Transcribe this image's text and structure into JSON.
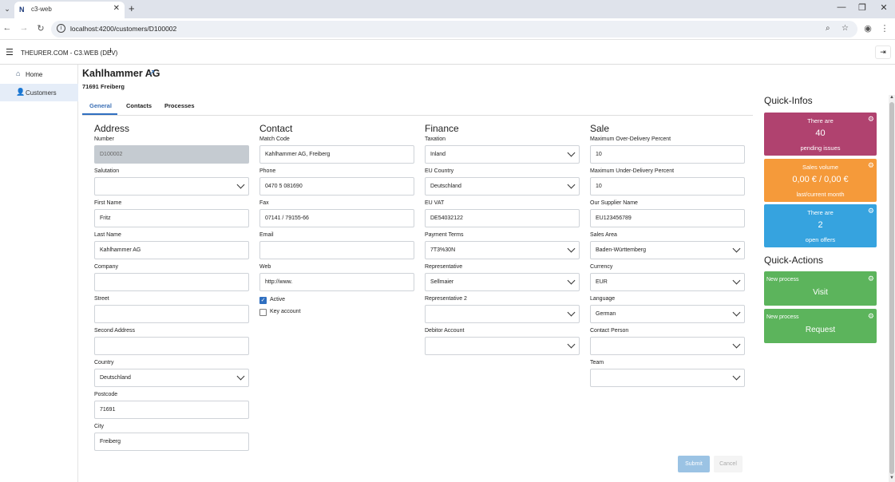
{
  "browser": {
    "tab_title": "c3-web",
    "tab_favicon": "N",
    "url": "localhost:4200/customers/D100002"
  },
  "app": {
    "title": "THEURER.COM - C3.WEB (DEV)",
    "info_glyph": "i"
  },
  "sidebar": {
    "items": [
      {
        "label": "Home",
        "icon": "home-icon"
      },
      {
        "label": "Customers",
        "icon": "user-icon"
      }
    ]
  },
  "customer": {
    "name": "Kahlhammer AG",
    "city_line": "71691 Freiberg"
  },
  "tabs": [
    "General",
    "Contacts",
    "Processes"
  ],
  "sections": {
    "address": "Address",
    "contact": "Contact",
    "finance": "Finance",
    "sale": "Sale"
  },
  "address": {
    "number_label": "Number",
    "number": "D100002",
    "salutation_label": "Salutation",
    "salutation": "",
    "first_name_label": "First Name",
    "first_name": "Fritz",
    "last_name_label": "Last Name",
    "last_name": "Kahlhammer AG",
    "company_label": "Company",
    "company": "",
    "street_label": "Street",
    "street": "",
    "second_address_label": "Second Address",
    "second_address": "",
    "country_label": "Country",
    "country": "Deutschland",
    "postcode_label": "Postcode",
    "postcode": "71691",
    "city_label": "City",
    "city": "Freiberg"
  },
  "contact": {
    "match_code_label": "Match Code",
    "match_code": "Kahlhammer AG, Freiberg",
    "phone_label": "Phone",
    "phone": "0470 5 081690",
    "fax_label": "Fax",
    "fax": "07141 / 79155-66",
    "email_label": "Email",
    "email": "",
    "web_label": "Web",
    "web": "http://www.",
    "active_label": "Active",
    "active": true,
    "key_account_label": "Key account",
    "key_account": false
  },
  "finance": {
    "taxation_label": "Taxation",
    "taxation": "Inland",
    "eu_country_label": "EU Country",
    "eu_country": "Deutschland",
    "eu_vat_label": "EU VAT",
    "eu_vat": "DE54032122",
    "payment_terms_label": "Payment Terms",
    "payment_terms": "7T3%30N",
    "representative_label": "Representative",
    "representative": "Sellmaier",
    "representative2_label": "Representative 2",
    "representative2": "",
    "debitor_account_label": "Debitor Account",
    "debitor_account": ""
  },
  "sale": {
    "max_over_label": "Maximum Over-Delivery Percent",
    "max_over": "10",
    "max_under_label": "Maximum Under-Delivery Percent",
    "max_under": "10",
    "supplier_name_label": "Our Supplier Name",
    "supplier_name": "EU123456789",
    "sales_area_label": "Sales Area",
    "sales_area": "Baden-Württemberg",
    "currency_label": "Currency",
    "currency": "EUR",
    "language_label": "Language",
    "language": "German",
    "contact_person_label": "Contact Person",
    "contact_person": "",
    "team_label": "Team",
    "team": ""
  },
  "buttons": {
    "submit": "Submit",
    "cancel": "Cancel"
  },
  "quick_infos": {
    "title": "Quick-Infos",
    "cards": [
      {
        "line1": "There are",
        "value": "40",
        "line3": "pending issues",
        "color": "#b0426f"
      },
      {
        "line1": "Sales volume",
        "value": "0,00 € / 0,00 €",
        "line3": "last/current month",
        "color": "#f59a3a"
      },
      {
        "line1": "There are",
        "value": "2",
        "line3": "open offers",
        "color": "#36a3df"
      }
    ]
  },
  "quick_actions": {
    "title": "Quick-Actions",
    "cards": [
      {
        "small": "New process",
        "name": "Visit"
      },
      {
        "small": "New process",
        "name": "Request"
      }
    ],
    "color": "#5cb45c"
  }
}
